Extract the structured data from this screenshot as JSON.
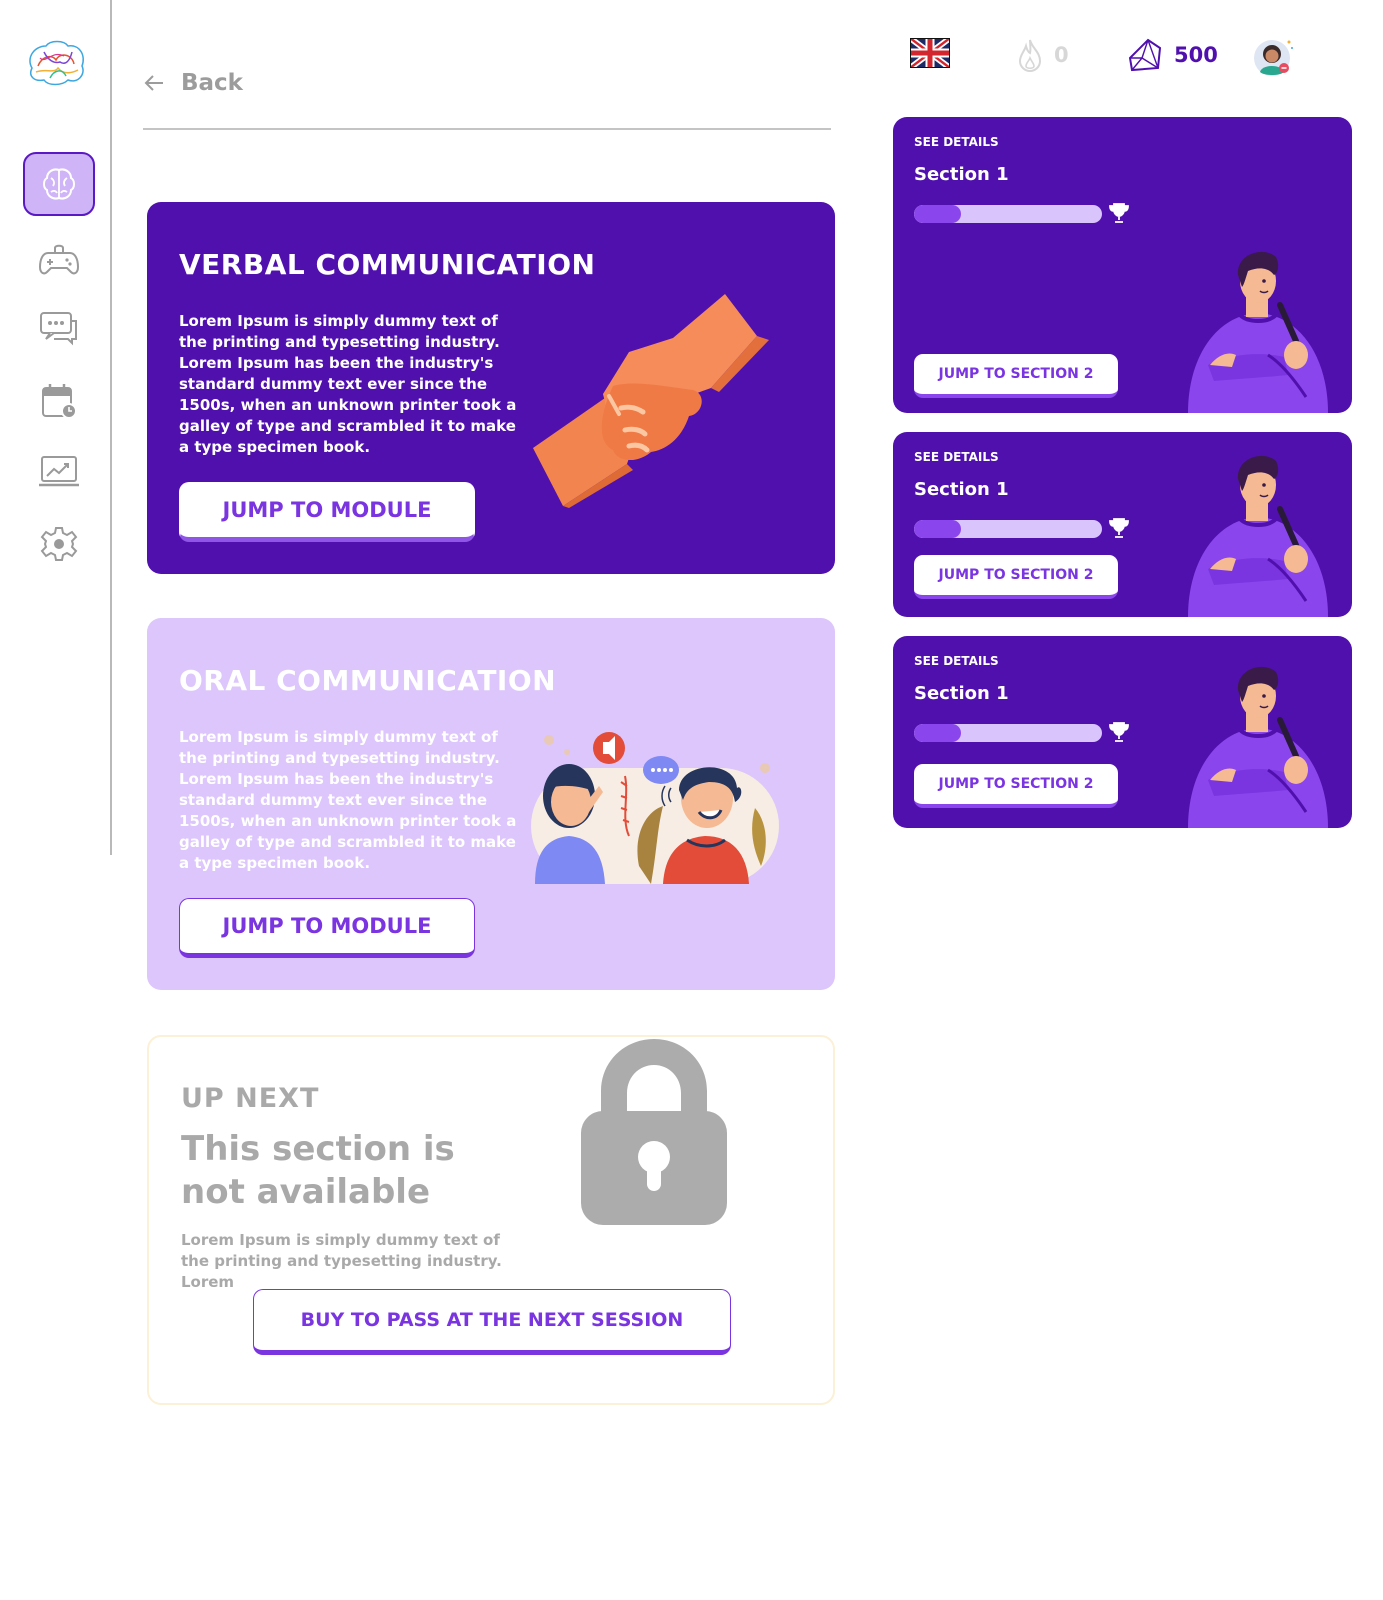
{
  "header": {
    "back_label": "Back"
  },
  "topbar": {
    "language_icon": "uk-flag-icon",
    "streak_count": "0",
    "gems_count": "500",
    "colors": {
      "gems": "#5010ad",
      "streak": "#d7d7d7"
    }
  },
  "sidebar": {
    "items": [
      {
        "name": "brain",
        "icon": "brain-icon",
        "active": true
      },
      {
        "name": "games",
        "icon": "gamepad-icon",
        "active": false
      },
      {
        "name": "chat",
        "icon": "chat-icon",
        "active": false
      },
      {
        "name": "calendar",
        "icon": "calendar-clock-icon",
        "active": false
      },
      {
        "name": "analytics",
        "icon": "chart-monitor-icon",
        "active": false
      },
      {
        "name": "settings",
        "icon": "gear-icon",
        "active": false
      }
    ]
  },
  "modules": [
    {
      "title": "VERBAL COMMUNICATION",
      "description": "Lorem Ipsum is simply dummy text of the printing and typesetting industry. Lorem Ipsum has been the industry's standard dummy text ever since the 1500s, when an unknown printer took a galley of type and scrambled it to make a type specimen book.",
      "button_label": "JUMP TO MODULE",
      "illustration": "handshake-illustration"
    },
    {
      "title": "ORAL COMMUNICATION",
      "description": "Lorem Ipsum is simply dummy text of the printing and typesetting industry. Lorem Ipsum has been the industry's standard dummy text ever since the 1500s, when an unknown printer took a galley of type and scrambled it to make a type specimen book.",
      "button_label": "JUMP TO MODULE",
      "illustration": "conversation-illustration"
    }
  ],
  "locked": {
    "kicker": "UP NEXT",
    "title": "This section is not available",
    "description": "Lorem Ipsum is simply dummy text of the printing and typesetting industry. Lorem",
    "button_label": "BUY TO PASS AT THE NEXT SESSION",
    "icon": "lock-icon"
  },
  "sections": [
    {
      "kicker": "SEE DETAILS",
      "title": "Section 1",
      "progress": 0.25,
      "button_label": "JUMP TO SECTION 2"
    },
    {
      "kicker": "SEE DETAILS",
      "title": "Section 1",
      "progress": 0.25,
      "button_label": "JUMP TO SECTION 2"
    },
    {
      "kicker": "SEE DETAILS",
      "title": "Section 1",
      "progress": 0.25,
      "button_label": "JUMP TO SECTION 2"
    }
  ],
  "colors": {
    "primary": "#5010ad",
    "accent": "#7a34e0",
    "light_purple": "#dcc6fb",
    "muted_gray": "#a9a9a9"
  }
}
